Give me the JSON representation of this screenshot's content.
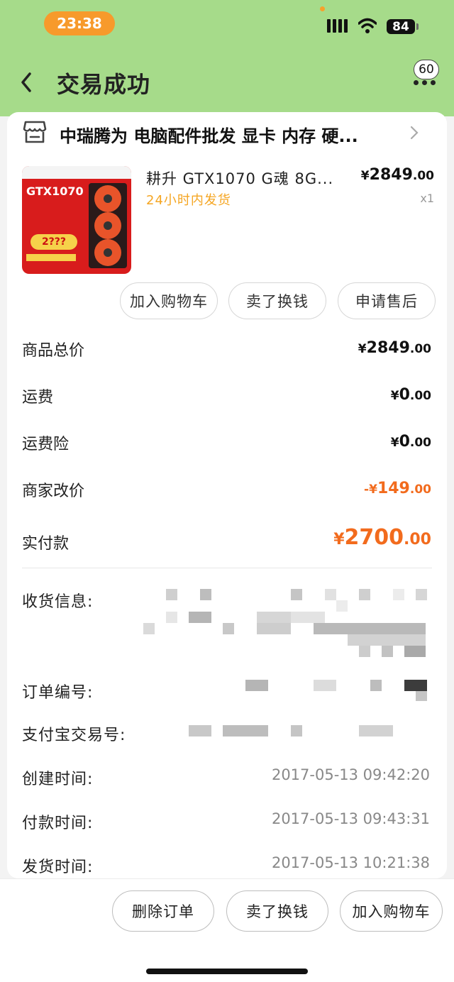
{
  "status_bar": {
    "time": "23:38",
    "battery": "84"
  },
  "header": {
    "title": "交易成功",
    "badge_count": "60"
  },
  "shop": {
    "name": "中瑞腾为 电脑配件批发 显卡 内存 硬..."
  },
  "product": {
    "name": "耕升 GTX1070 G魂 8G...",
    "tag": "24小时内发货",
    "price_currency": "¥",
    "price_int": "2849",
    "price_dec": ".00",
    "qty": "x1",
    "image_text": {
      "model": "GTX1070",
      "bubble": "2???"
    }
  },
  "item_actions": [
    "加入购物车",
    "卖了换钱",
    "申请售后"
  ],
  "summary": [
    {
      "label": "商品总价",
      "sign": "",
      "currency": "¥",
      "int": "2849",
      "dec": ".00"
    },
    {
      "label": "运费",
      "sign": "",
      "currency": "¥",
      "int": "0",
      "dec": ".00"
    },
    {
      "label": "运费险",
      "sign": "",
      "currency": "¥",
      "int": "0",
      "dec": ".00"
    },
    {
      "label": "商家改价",
      "sign": "-",
      "currency": "¥",
      "int": "149",
      "dec": ".00"
    },
    {
      "label": "实付款",
      "sign": "",
      "currency": "¥",
      "int": "2700",
      "dec": ".00"
    }
  ],
  "order_info": {
    "address_label": "收货信息:",
    "order_no_label": "订单编号:",
    "alipay_label": "支付宝交易号:",
    "created_label": "创建时间:",
    "created_value": "2017-05-13 09:42:20",
    "paid_label": "付款时间:",
    "paid_value": "2017-05-13 09:43:31",
    "shipped_label": "发货时间:",
    "shipped_value": "2017-05-13 10:21:38"
  },
  "bottom_actions": [
    "删除订单",
    "卖了换钱",
    "加入购物车"
  ],
  "colors": {
    "header_bg": "#a6db8a",
    "accent": "#f26b1d",
    "tag": "#f5a623",
    "time_pill": "#f79a2b"
  }
}
